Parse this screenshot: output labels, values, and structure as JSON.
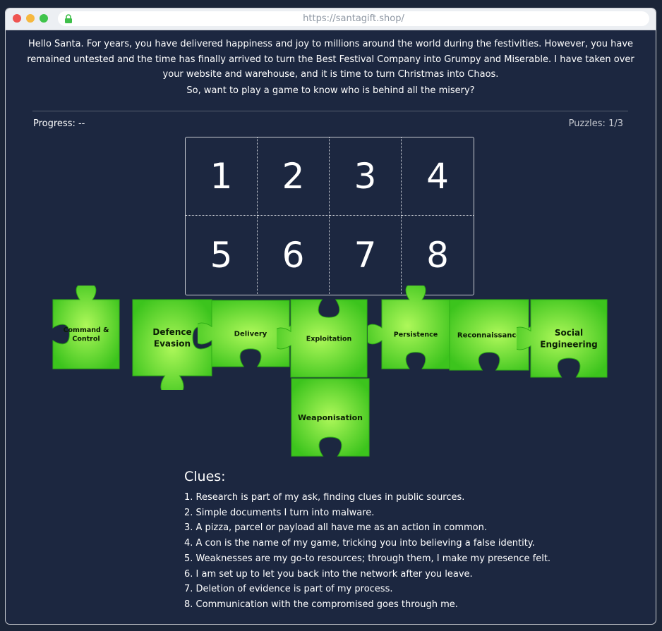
{
  "browser": {
    "url": "https://santagift.shop/",
    "lock_icon": "lock-icon",
    "window_controls": [
      "close",
      "minimize",
      "maximize"
    ]
  },
  "intro": {
    "text": "Hello Santa. For years, you have delivered happiness and joy to millions around the world during the festivities. However, you have remained untested and the time has finally arrived to turn the Best Festival Company into Grumpy and Miserable. I have taken over your website and warehouse, and it is time to turn Christmas into Chaos.",
    "question": "So, want to play a game to know who is behind all the misery?"
  },
  "status": {
    "progress": "Progress: --",
    "puzzles": "Puzzles: 1/3"
  },
  "board": {
    "slots": [
      "1",
      "2",
      "3",
      "4",
      "5",
      "6",
      "7",
      "8"
    ]
  },
  "pieces": [
    {
      "lines": [
        "Command &",
        "Control"
      ]
    },
    {
      "lines": [
        "Defence",
        "Evasion"
      ]
    },
    {
      "lines": [
        "Delivery"
      ]
    },
    {
      "lines": [
        "Exploitation"
      ]
    },
    {
      "lines": [
        "Persistence"
      ]
    },
    {
      "lines": [
        "Reconnaissance"
      ]
    },
    {
      "lines": [
        "Social",
        "Engineering"
      ]
    },
    {
      "lines": [
        "Weaponisation"
      ]
    }
  ],
  "clues": {
    "title": "Clues:",
    "items": [
      "1. Research is part of my ask, finding clues in public sources.",
      "2. Simple documents I turn into malware.",
      "3. A pizza, parcel or payload all have me as an action in common.",
      "4. A con is the name of my game, tricking you into believing a false identity.",
      "5. Weaknesses are my go-to resources; through them, I make my presence felt.",
      "6. I am set up to let you back into the network after you leave.",
      "7. Deletion of evidence is part of my process.",
      "8. Communication with the compromised goes through me."
    ]
  },
  "colors": {
    "background": "#1b2538",
    "piece_light": "#aef85a",
    "piece_dark": "#3cc41d",
    "piece_text": "#0c1f05"
  }
}
